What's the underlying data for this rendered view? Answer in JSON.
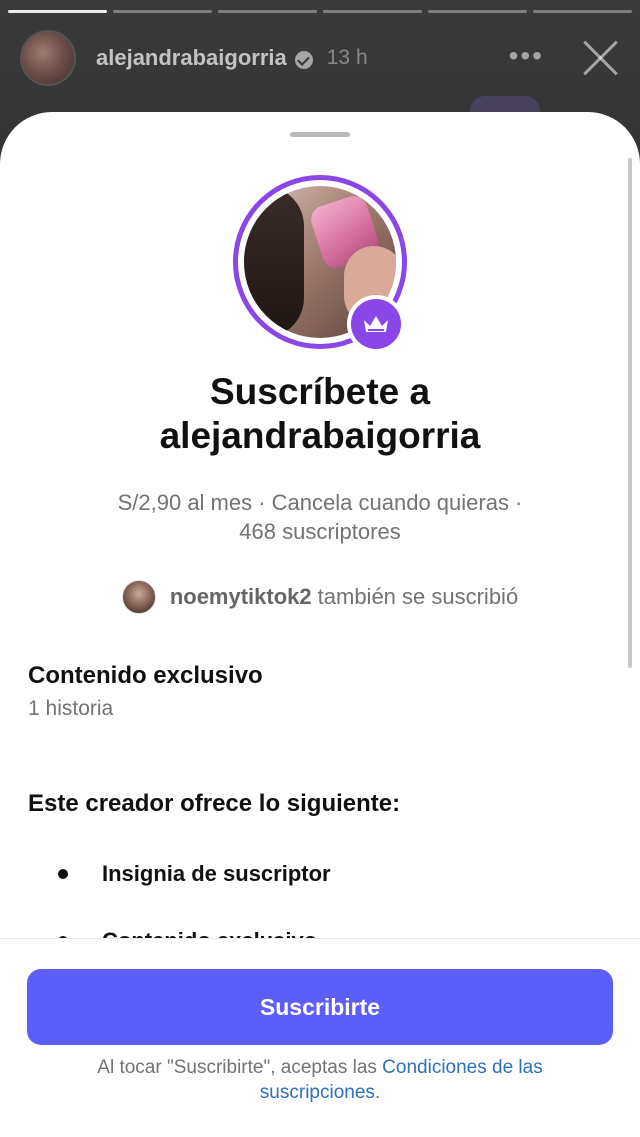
{
  "story": {
    "username": "alejandrabaigorria",
    "time": "13 h",
    "more_label": "•••",
    "progress_total": 6,
    "progress_done": 1
  },
  "sheet": {
    "title_line1": "Suscríbete a",
    "title_line2": "alejandrabaigorria",
    "subtitle_line1": "S/2,90 al mes · Cancela cuando quieras ·",
    "subtitle_line2": "468 suscriptores",
    "also_user": "noemytiktok2",
    "also_text": "también se suscribió",
    "exclusive_title": "Contenido exclusivo",
    "exclusive_count": "1 historia",
    "offers_title": "Este creador ofrece lo siguiente:",
    "benefits": [
      "Insignia de suscriptor",
      "Contenido exclusivo"
    ],
    "subscribe_button": "Suscribirte",
    "terms_prefix": "Al tocar \"Suscribirte\", aceptas las ",
    "terms_link_1": "Condiciones de las",
    "terms_link_2": "suscripciones",
    "terms_suffix": "."
  },
  "colors": {
    "accent": "#5b5ff7",
    "ring": "#8b46e8",
    "link": "#2f6fc2"
  }
}
